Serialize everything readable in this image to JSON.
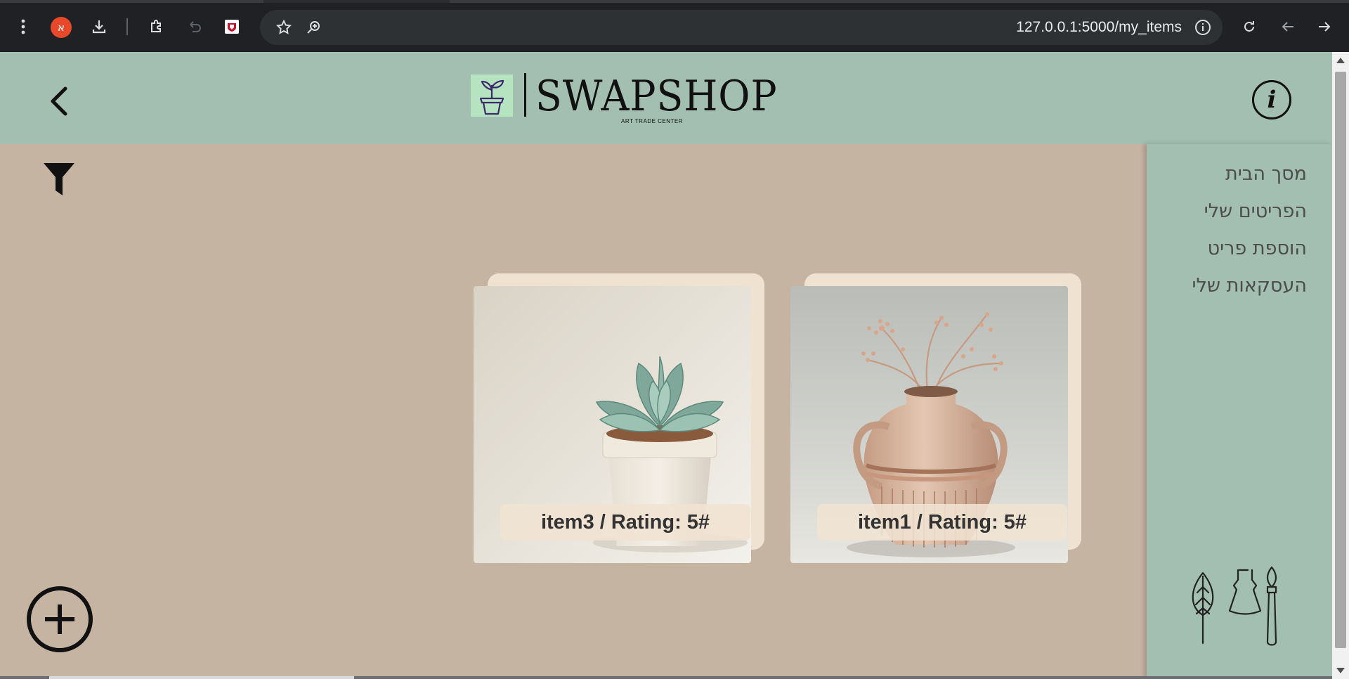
{
  "browser": {
    "profile_letter": "א",
    "url": "127.0.0.1:5000/my_items",
    "menu_icon": "more-vert-icon",
    "download_icon": "download-icon",
    "extensions_icon": "puzzle-icon",
    "undo_icon": "undo-icon",
    "mcafee_icon": "shield-extension-icon",
    "bookmark_icon": "star-icon",
    "zoom_icon": "zoom-icon",
    "info_icon": "info-icon",
    "reload_icon": "reload-icon",
    "back_icon": "arrow-left-icon",
    "forward_icon": "arrow-right-icon"
  },
  "header": {
    "brand": "SWAPSHOP",
    "tagline": "ART TRADE CENTER",
    "back_icon": "chevron-left-icon",
    "info_label": "i"
  },
  "sidebar": {
    "items": [
      {
        "label": "מסך הבית"
      },
      {
        "label": "הפריטים שלי"
      },
      {
        "label": "הוספת פריט"
      },
      {
        "label": "העסקאות שלי"
      }
    ],
    "decoration_icons": [
      "leaf-icon",
      "dress-icon",
      "paintbrush-icon"
    ]
  },
  "toolbar": {
    "filter_icon": "filter-icon",
    "add_icon": "plus-circle-icon"
  },
  "items": [
    {
      "label": "item1 / Rating: 5#",
      "image": "clay-vase-with-dried-flowers"
    },
    {
      "label": "item3 / Rating: 5#",
      "image": "succulent-in-pot"
    }
  ],
  "colors": {
    "header_bg": "#a2bfb1",
    "content_bg": "#c6b4a2",
    "card_back": "#f0e2d1",
    "logo_plant_bg": "#b6e3c0"
  }
}
